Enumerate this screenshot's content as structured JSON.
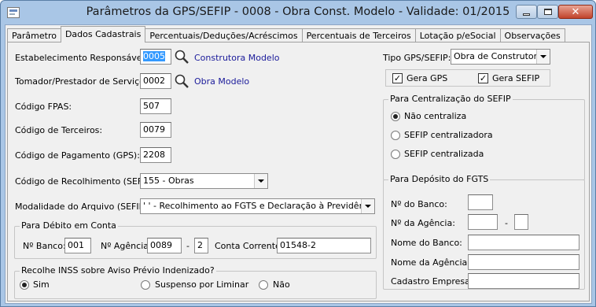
{
  "window": {
    "title": "Parâmetros da GPS/SEFIP - 0008 - Obra Const. Modelo - Validade: 01/2015",
    "close_glyph": "✕"
  },
  "tabs": [
    "Parâmetro",
    "Dados Cadastrais",
    "Percentuais/Deduções/Acréscimos",
    "Percentuais de Terceiros",
    "Lotação p/eSocial",
    "Observações"
  ],
  "form": {
    "estabelecimento": {
      "label": "Estabelecimento Responsável:",
      "value": "0005",
      "link": "Construtora Modelo"
    },
    "tomador": {
      "label": "Tomador/Prestador de Serviço:",
      "value": "0002",
      "link": "Obra Modelo"
    },
    "fpas": {
      "label": "Código FPAS:",
      "value": "507"
    },
    "terceiros": {
      "label": "Código de Terceiros:",
      "value": "0079"
    },
    "pagamento": {
      "label": "Código de Pagamento (GPS):",
      "value": "2208"
    },
    "recolhimento": {
      "label": "Código de Recolhimento (SEFIP):",
      "value": "155 - Obras"
    },
    "modalidade": {
      "label": "Modalidade do Arquivo (SEFIP):",
      "value": "' ' - Recolhimento ao FGTS e Declaração à Previdência"
    }
  },
  "debito": {
    "group": "Para Débito em Conta",
    "banco_label": "Nº Banco:",
    "banco": "001",
    "agencia_label": "Nº Agência:",
    "agencia": "0089",
    "dash": "-",
    "agencia_dv": "2",
    "conta_label": "Conta Corrente:",
    "conta": "01548-2"
  },
  "inss": {
    "group": "Recolhe INSS sobre Aviso Prévio Indenizado?",
    "options": [
      "Sim",
      "Suspenso por Liminar",
      "Não"
    ],
    "selected": "Sim"
  },
  "tipo": {
    "label": "Tipo GPS/SEFIP:",
    "value": "Obra de Construtora",
    "gera_gps": "Gera GPS",
    "gera_sefip": "Gera SEFIP",
    "check": "✓"
  },
  "centralizacao": {
    "group": "Para Centralização do SEFIP",
    "options": [
      "Não centraliza",
      "SEFIP centralizadora",
      "SEFIP centralizada"
    ],
    "selected": "Não centraliza"
  },
  "fgts": {
    "group": "Para Depósito do FGTS",
    "banco_label": "Nº do Banco:",
    "agencia_label": "Nº da Agência:",
    "dash": "-",
    "nome_banco_label": "Nome do Banco:",
    "nome_agencia_label": "Nome da Agência:",
    "cadastro_label": "Cadastro Empresa:"
  }
}
